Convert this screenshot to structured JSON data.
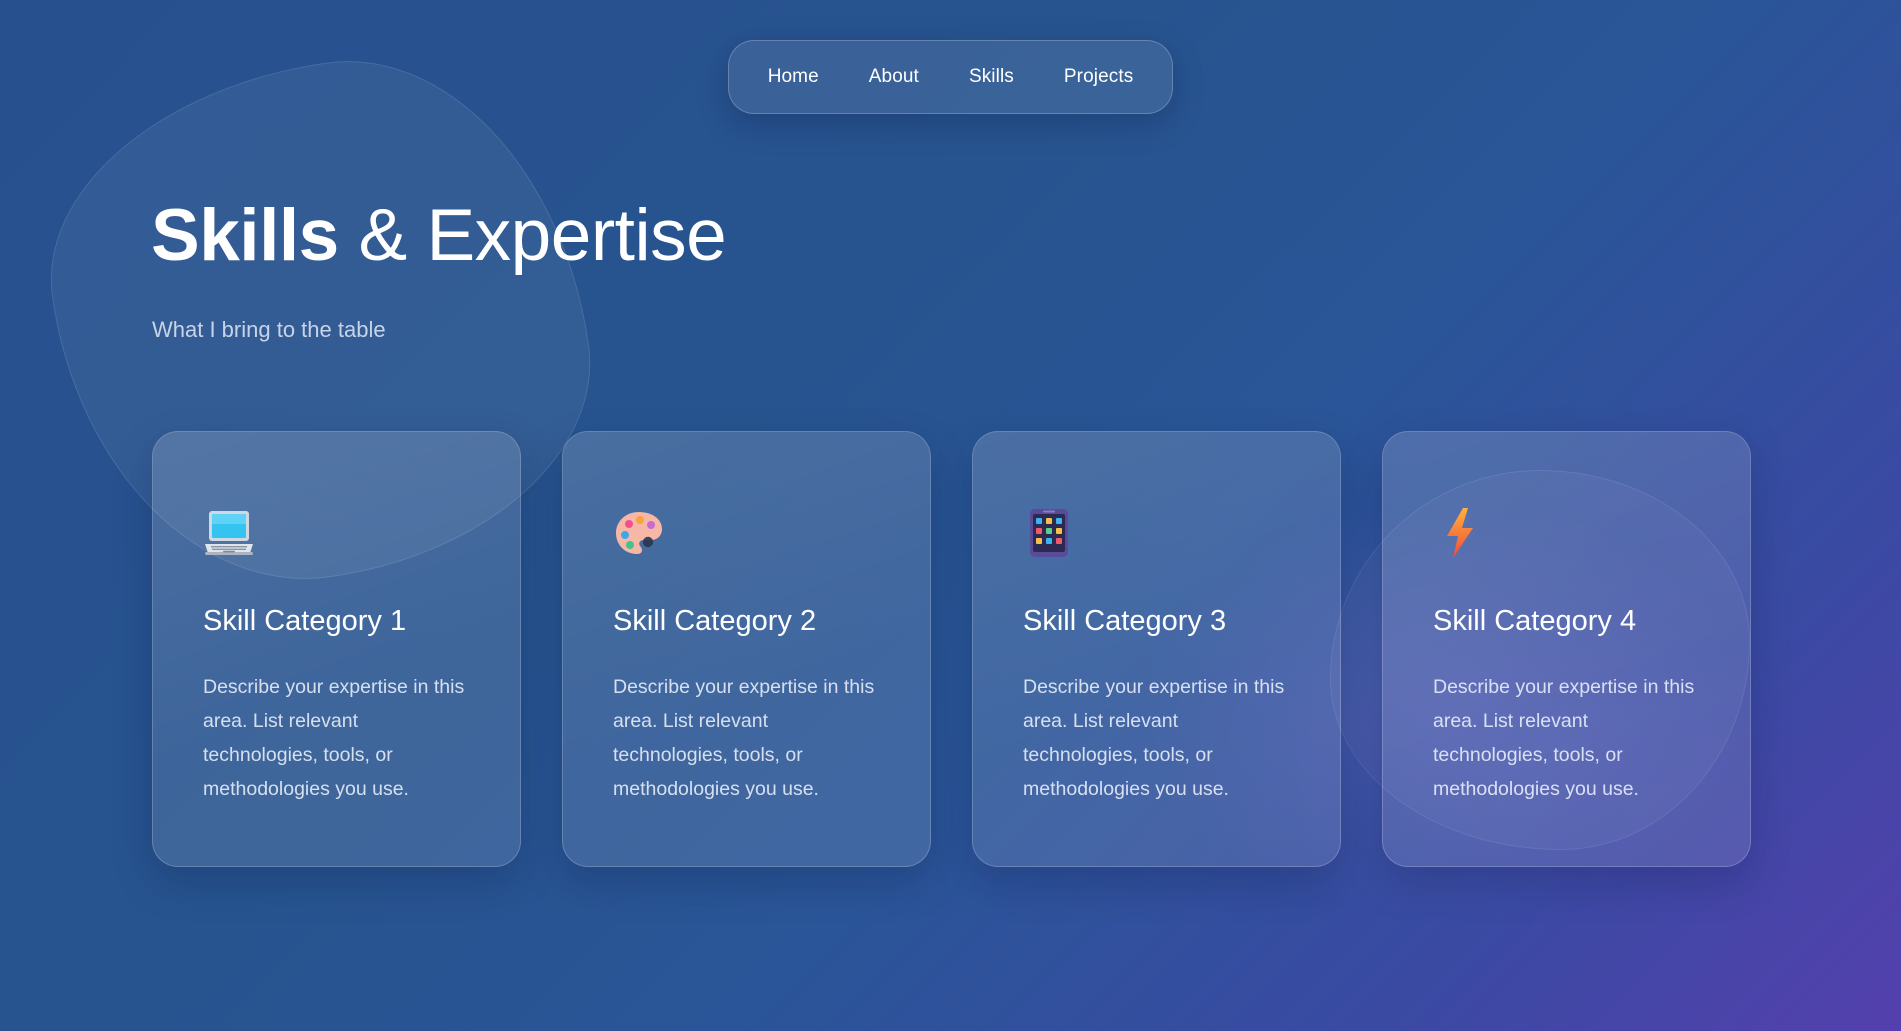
{
  "nav": {
    "items": [
      {
        "label": "Home"
      },
      {
        "label": "About"
      },
      {
        "label": "Skills"
      },
      {
        "label": "Projects"
      }
    ]
  },
  "header": {
    "title_bold": "Skills",
    "title_rest": " & Expertise",
    "subtitle": "What I bring to the table"
  },
  "cards": [
    {
      "icon": "laptop-icon",
      "title": "Skill Category 1",
      "description": "Describe your expertise in this area. List relevant technologies, tools, or methodologies you use."
    },
    {
      "icon": "palette-icon",
      "title": "Skill Category 2",
      "description": "Describe your expertise in this area. List relevant technologies, tools, or methodologies you use."
    },
    {
      "icon": "mobile-phone-icon",
      "title": "Skill Category 3",
      "description": "Describe your expertise in this area. List relevant technologies, tools, or methodologies you use."
    },
    {
      "icon": "lightning-icon",
      "title": "Skill Category 4",
      "description": "Describe your expertise in this area. List relevant technologies, tools, or methodologies you use."
    }
  ],
  "colors": {
    "background_start": "#27508f",
    "background_end": "#5440ad",
    "text": "#ffffff"
  }
}
